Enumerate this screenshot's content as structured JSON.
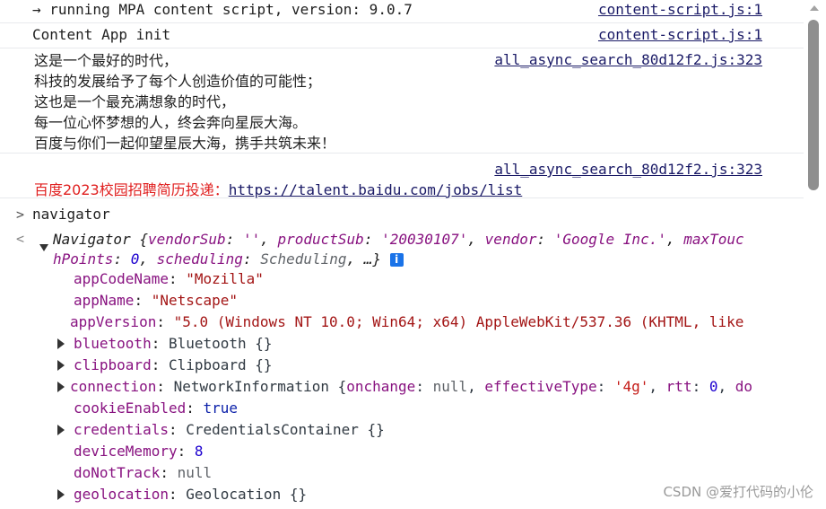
{
  "messages": [
    {
      "text": "→ running MPA content script, version: 9.0.7",
      "source": "content-script.js:1"
    },
    {
      "text": "Content App init",
      "source": "content-script.js:1"
    },
    {
      "lines": [
        "这是一个最好的时代，",
        "科技的发展给予了每个人创造价值的可能性；",
        "这也是一个最充满想象的时代，",
        "每一位心怀梦想的人，终会奔向星辰大海。",
        "百度与你们一起仰望星辰大海，携手共筑未来！"
      ],
      "source": "all_async_search_80d12f2.js:323"
    },
    {
      "recruit_text": "百度2023校园招聘简历投递：",
      "recruit_link": "https://talent.baidu.com/jobs/list",
      "source": "all_async_search_80d12f2.js:323"
    }
  ],
  "prompt": {
    "command": "navigator"
  },
  "result": {
    "summary_line1": {
      "name": "Navigator",
      "open": "{",
      "k1": "vendorSub",
      "v1": "''",
      "k2": "productSub",
      "v2": "'20030107'",
      "k3": "vendor",
      "v3": "'Google Inc.'",
      "k4": "maxTouc"
    },
    "summary_line2": {
      "k4rest": "hPoints",
      "v4": "0",
      "k5": "scheduling",
      "v5": "Scheduling",
      "tail": ", …}"
    },
    "info_icon": "i",
    "properties": [
      {
        "key": "appCodeName",
        "value": "\"Mozilla\"",
        "expandable": false,
        "type": "string"
      },
      {
        "key": "appName",
        "value": "\"Netscape\"",
        "expandable": false,
        "type": "string"
      },
      {
        "key": "appVersion",
        "value": "\"5.0 (Windows NT 10.0; Win64; x64) AppleWebKit/537.36 (KHTML, like",
        "expandable": false,
        "type": "string"
      },
      {
        "key": "bluetooth",
        "value": "Bluetooth {}",
        "expandable": true,
        "type": "object"
      },
      {
        "key": "clipboard",
        "value": "Clipboard {}",
        "expandable": true,
        "type": "object"
      },
      {
        "key": "connection",
        "value_parts": {
          "obj": "NetworkInformation {",
          "k1": "onchange",
          "v1": "null",
          "k2": "effectiveType",
          "v2": "'4g'",
          "k3": "rtt",
          "v3": "0",
          "k4": "do"
        },
        "expandable": true,
        "type": "object"
      },
      {
        "key": "cookieEnabled",
        "value": "true",
        "expandable": false,
        "type": "bool"
      },
      {
        "key": "credentials",
        "value": "CredentialsContainer {}",
        "expandable": true,
        "type": "object"
      },
      {
        "key": "deviceMemory",
        "value": "8",
        "expandable": false,
        "type": "number"
      },
      {
        "key": "doNotTrack",
        "value": "null",
        "expandable": false,
        "type": "null"
      },
      {
        "key": "geolocation",
        "value": "Geolocation {}",
        "expandable": true,
        "type": "object"
      }
    ]
  },
  "watermark": "CSDN @爱打代码的小伦",
  "icons": {
    "prompt": "chevron-right-icon",
    "result": "chevron-left-icon",
    "expand": "triangle-down-icon",
    "collapsed": "triangle-right-icon",
    "info": "info-icon"
  }
}
